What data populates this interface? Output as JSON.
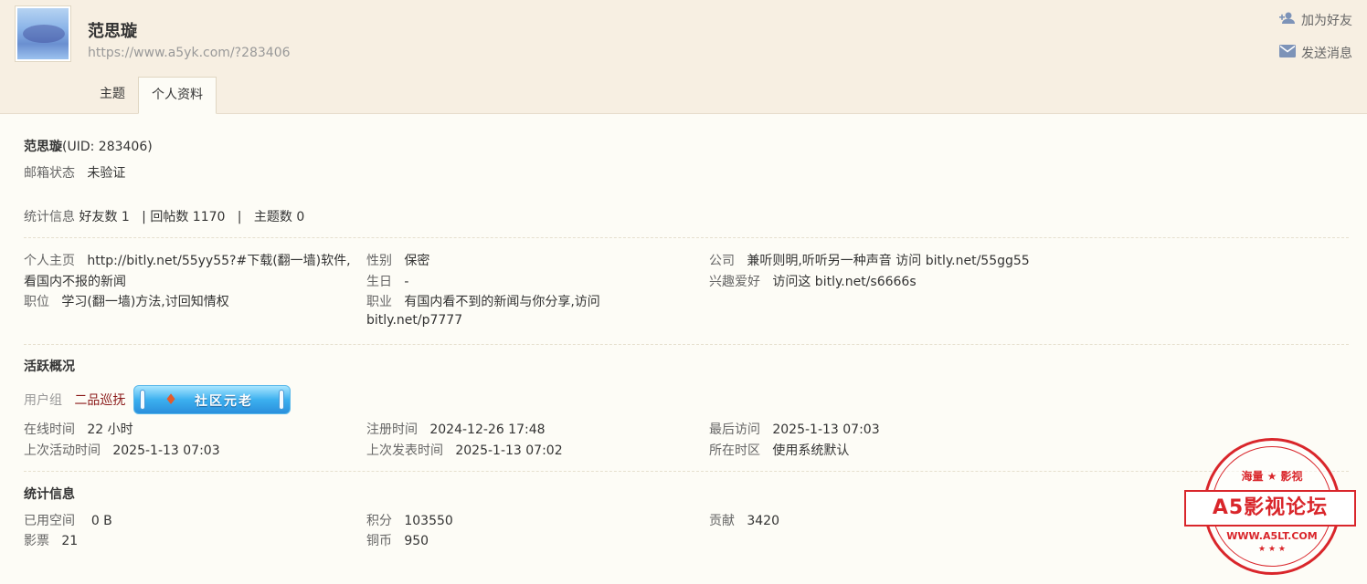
{
  "header": {
    "name": "范思璇",
    "url": "https://www.a5yk.com/?283406",
    "add_friend": "加为好友",
    "send_message": "发送消息",
    "tabs": [
      {
        "label": "主题"
      },
      {
        "label": "个人资料"
      }
    ]
  },
  "profile": {
    "name": "范思璇",
    "uid": "(UID: 283406)",
    "email_label": "邮箱状态",
    "email_value": "未验证",
    "stats_label": "统计信息",
    "friends": "好友数 1",
    "replies": "回帖数 1170",
    "threads": "主题数 0",
    "sep": "|"
  },
  "details": {
    "homepage_label": "个人主页",
    "homepage_value1": "http://bitly.net/55yy55?#下载(翻一墙)软件,",
    "homepage_value2": "看国内不报的新闻",
    "position_label": "职位",
    "position_value": "学习(翻一墙)方法,讨回知情权",
    "gender_label": "性别",
    "gender_value": "保密",
    "birthday_label": "生日",
    "birthday_value": "-",
    "job_label": "职业",
    "job_value1": "有国内看不到的新闻与你分享,访问",
    "job_value2": "bitly.net/p7777",
    "company_label": "公司",
    "company_value": "兼听则明,听听另一种声音 访问 bitly.net/55gg55",
    "hobby_label": "兴趣爱好",
    "hobby_value": "访问这 bitly.net/s6666s"
  },
  "activity": {
    "title": "活跃概况",
    "group_label": "用户组",
    "group_value": "二品巡抚",
    "badge_text": "社区元老",
    "badge_icon": "gem-icon",
    "online_label": "在线时间",
    "online_value": "22 小时",
    "reg_label": "注册时间",
    "reg_value": "2024-12-26 17:48",
    "last_visit_label": "最后访问",
    "last_visit_value": "2025-1-13 07:03",
    "last_active_label": "上次活动时间",
    "last_active_value": "2025-1-13 07:03",
    "last_post_label": "上次发表时间",
    "last_post_value": "2025-1-13 07:02",
    "tz_label": "所在时区",
    "tz_value": "使用系统默认"
  },
  "stats": {
    "title": "统计信息",
    "space_label": "已用空间",
    "space_value": "0 B",
    "points_label": "积分",
    "points_value": "103550",
    "contrib_label": "贡献",
    "contrib_value": "3420",
    "votes_label": "影票",
    "votes_value": "21",
    "coins_label": "铜币",
    "coins_value": "950"
  },
  "watermark": {
    "top": "海量 ★ 影视",
    "main": "A5影视论坛",
    "url": "WWW.A5LT.COM",
    "stars": "★ ★ ★"
  },
  "colors": {
    "header_bg": "#f7efe2",
    "page_bg": "#fdfcf6",
    "stamp_red": "#d9262b",
    "badge_blue": "#3cb0ef"
  }
}
